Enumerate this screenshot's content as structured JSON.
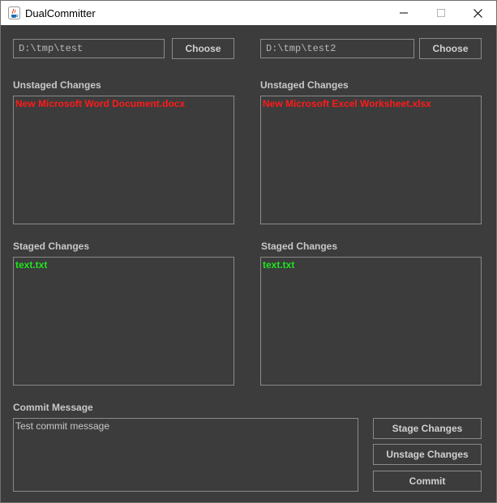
{
  "window": {
    "title": "DualCommitter",
    "icon": "java-cup-icon"
  },
  "left": {
    "path": "D:\\tmp\\test",
    "choose_label": "Choose",
    "unstaged_label": "Unstaged Changes",
    "unstaged_items": [
      "New Microsoft Word Document.docx"
    ],
    "staged_label": "Staged Changes",
    "staged_items": [
      "text.txt"
    ]
  },
  "right": {
    "path": "D:\\tmp\\test2",
    "choose_label": "Choose",
    "unstaged_label": "Unstaged Changes",
    "unstaged_items": [
      "New Microsoft Excel Worksheet.xlsx"
    ],
    "staged_label": "Staged Changes",
    "staged_items": [
      "text.txt"
    ]
  },
  "commit": {
    "label": "Commit Message",
    "message": "Test commit message",
    "stage_label": "Stage Changes",
    "unstage_label": "Unstage Changes",
    "commit_label": "Commit"
  },
  "colors": {
    "background": "#3c3c3c",
    "unstaged_text": "#ff1a1a",
    "staged_text": "#1ee61e",
    "border": "#8a8a8a"
  }
}
